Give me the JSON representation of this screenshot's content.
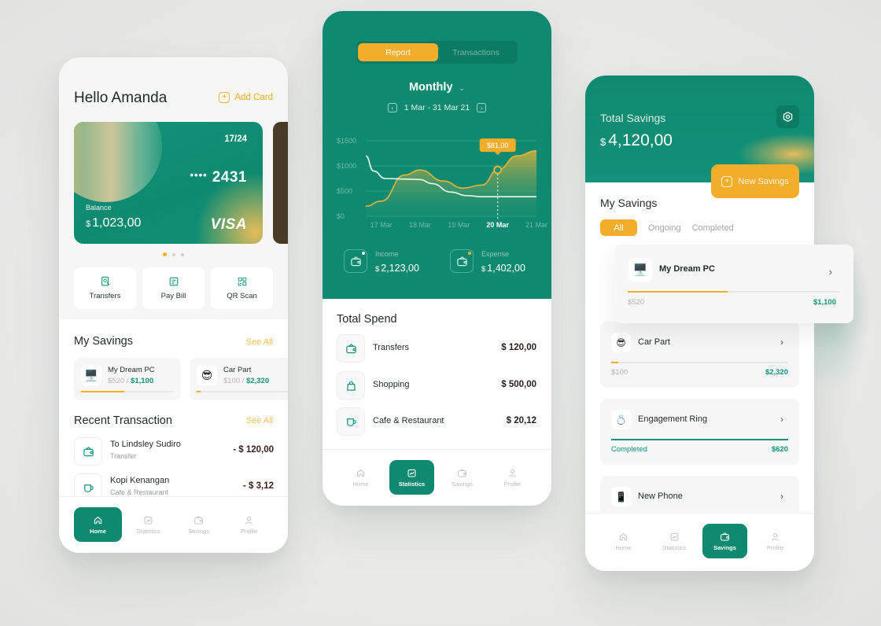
{
  "colors": {
    "brand_green": "#0f8a70",
    "accent_orange": "#f2ae2a",
    "text_dark": "#1e2a26"
  },
  "home": {
    "greeting": "Hello Amanda",
    "add_card_label": "Add Card",
    "card": {
      "expiry": "17/24",
      "masked": "••••",
      "last4": "2431",
      "balance_label": "Balance",
      "currency": "$",
      "balance": "1,023,00",
      "brand": "VISA"
    },
    "carousel": {
      "count": 3,
      "active_index": 0
    },
    "quick_actions": [
      {
        "label": "Transfers",
        "icon": "transfer-doc-icon"
      },
      {
        "label": "Pay Bill",
        "icon": "bill-icon"
      },
      {
        "label": "QR Scan",
        "icon": "qr-scan-icon"
      }
    ],
    "savings": {
      "title": "My Savings",
      "see_all": "See All",
      "items": [
        {
          "icon": "🖥️",
          "name": "My Dream PC",
          "saved": "$520",
          "separator": "/",
          "goal": "$1,100",
          "progress": 0.47
        },
        {
          "icon": "😎",
          "name": "Car Part",
          "saved": "$100",
          "separator": "/",
          "goal": "$2,320",
          "progress": 0.04
        }
      ]
    },
    "transactions": {
      "title": "Recent Transaction",
      "see_all": "See All",
      "items": [
        {
          "name": "To Lindsley Sudiro",
          "category": "Transfer",
          "amount": "- $ 120,00",
          "icon": "wallet-icon"
        },
        {
          "name": "Kopi Kenangan",
          "category": "Cafe & Restaurant",
          "amount": "- $ 3,12",
          "icon": "cup-icon"
        }
      ]
    }
  },
  "statistics": {
    "tabs": [
      {
        "label": "Report",
        "active": true
      },
      {
        "label": "Transactions",
        "active": false
      }
    ],
    "period": "Monthly",
    "date_range": "1 Mar - 31 Mar 21",
    "tooltip": "$81,00",
    "income": {
      "label": "Income",
      "currency": "$",
      "value": "2,123,00"
    },
    "expense": {
      "label": "Expense",
      "currency": "$",
      "value": "1,402,00"
    },
    "spend": {
      "title": "Total Spend",
      "items": [
        {
          "name": "Transfers",
          "amount": "$ 120,00",
          "icon": "wallet-icon"
        },
        {
          "name": "Shopping",
          "amount": "$ 500,00",
          "icon": "shopping-bag-icon"
        },
        {
          "name": "Cafe & Restaurant",
          "amount": "$ 20,12",
          "icon": "cup-icon"
        }
      ]
    }
  },
  "chart_data": {
    "type": "line",
    "title": "",
    "xlabel": "",
    "ylabel": "",
    "categories": [
      "17 Mar",
      "18 Mar",
      "19 Mar",
      "20 Mar",
      "21 Mar"
    ],
    "highlight_category": "20 Mar",
    "y_ticks": [
      "$0",
      "$500",
      "$1000",
      "$1500"
    ],
    "ylim": [
      0,
      1500
    ],
    "grid": true,
    "series": [
      {
        "name": "Income",
        "style": "area",
        "color": "#e9b43a",
        "x": [
          16.6,
          17.0,
          17.6,
          18.0,
          18.6,
          19.1,
          19.6,
          20.0,
          20.5,
          21.0
        ],
        "values": [
          200,
          300,
          820,
          920,
          700,
          560,
          620,
          920,
          1200,
          1300
        ]
      },
      {
        "name": "Expense",
        "style": "line",
        "color": "#e8f6f1",
        "x": [
          16.6,
          16.8,
          17.1,
          17.6,
          18.0,
          18.3,
          18.8,
          19.2,
          19.6,
          20.0,
          21.0
        ],
        "values": [
          1200,
          900,
          750,
          740,
          730,
          650,
          480,
          410,
          390,
          390,
          390
        ]
      }
    ]
  },
  "savings_page": {
    "total_label": "Total Savings",
    "currency": "$",
    "total_value": "4,120,00",
    "new_button": "New Savings",
    "title": "My Savings",
    "filters": [
      {
        "label": "All",
        "active": true
      },
      {
        "label": "Ongoing",
        "active": false
      },
      {
        "label": "Completed",
        "active": false
      }
    ],
    "featured": {
      "icon": "🖥️",
      "name": "My Dream PC",
      "saved": "$520",
      "goal": "$1,100",
      "progress": 0.47
    },
    "items": [
      {
        "icon": "😎",
        "name": "Car Part",
        "saved": "$100",
        "goal": "$2,320",
        "progress": 0.04,
        "status": ""
      },
      {
        "icon": "💍",
        "name": "Engagement Ring",
        "saved": "Completed",
        "goal": "$620",
        "progress": 1.0,
        "status": "completed"
      },
      {
        "icon": "📱",
        "name": "New Phone",
        "saved": "",
        "goal": "",
        "progress": 0,
        "status": ""
      }
    ]
  },
  "nav": {
    "items": [
      {
        "label": "Home",
        "icon": "home-icon"
      },
      {
        "label": "Statistics",
        "icon": "statistics-icon"
      },
      {
        "label": "Savings",
        "icon": "savings-icon"
      },
      {
        "label": "Profile",
        "icon": "profile-icon"
      }
    ]
  }
}
